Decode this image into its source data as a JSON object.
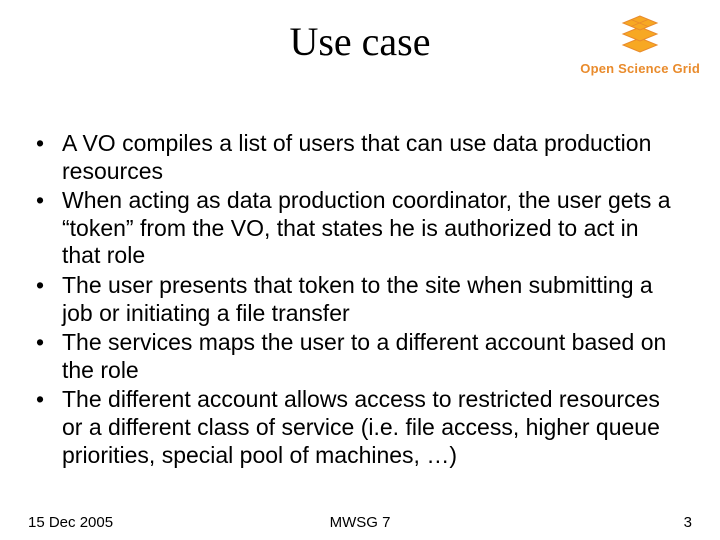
{
  "title": "Use case",
  "logo": {
    "text": "Open Science Grid",
    "icon_name": "stacked-grids-icon",
    "color": "#f7a823",
    "stroke": "#e98b2c"
  },
  "bullets": [
    "A VO compiles a list of users that can use data production resources",
    "When acting as data production coordinator, the user gets a “token” from the VO, that states he is authorized to act in that role",
    "The user presents that token to the site when submitting a job or initiating a file transfer",
    "The services maps the user to a different account based on the role",
    "The different account allows access to restricted resources or a different class of service (i.e. file access, higher queue priorities, special pool of machines, …)"
  ],
  "footer": {
    "date": "15 Dec 2005",
    "center": "MWSG 7",
    "page": "3"
  }
}
